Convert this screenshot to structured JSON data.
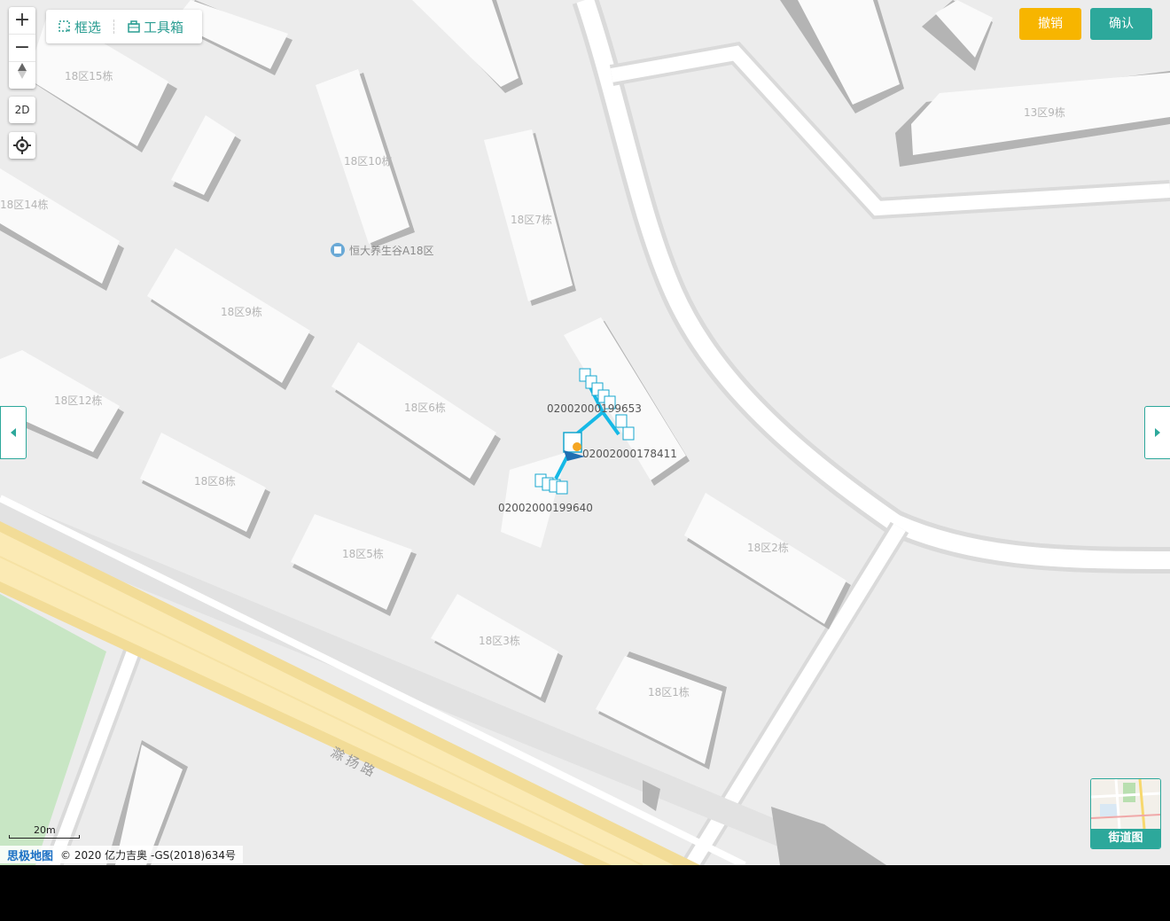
{
  "toolbar": {
    "select_label": "框选",
    "toolbox_label": "工具箱"
  },
  "map_controls": {
    "zoom_in": "+",
    "zoom_out": "−",
    "compass": "▲",
    "view_mode": "2D"
  },
  "actions": {
    "undo_label": "撤销",
    "confirm_label": "确认"
  },
  "buildings": [
    "18区15栋",
    "18区10栋",
    "18区14栋",
    "18区7栋",
    "18区9栋",
    "18区12栋",
    "18区6栋",
    "18区8栋",
    "18区5栋",
    "18区3栋",
    "18区1栋",
    "18区2栋",
    "13区9栋"
  ],
  "poi": {
    "name": "恒大养生谷A18区"
  },
  "road": {
    "name": "滁扬路"
  },
  "devices": [
    "02002000199653",
    "02002000178411",
    "02002000199640"
  ],
  "street_view": {
    "label": "街道图"
  },
  "scale": {
    "label": "20m"
  },
  "attribution": {
    "logo": "思极地图",
    "copyright": "© 2020 亿力吉奥 -GS(2018)634号"
  },
  "colors": {
    "accent": "#2da89b",
    "undo": "#f7b500",
    "device_line": "#16b9e6",
    "device_marker": "#f5a623"
  }
}
